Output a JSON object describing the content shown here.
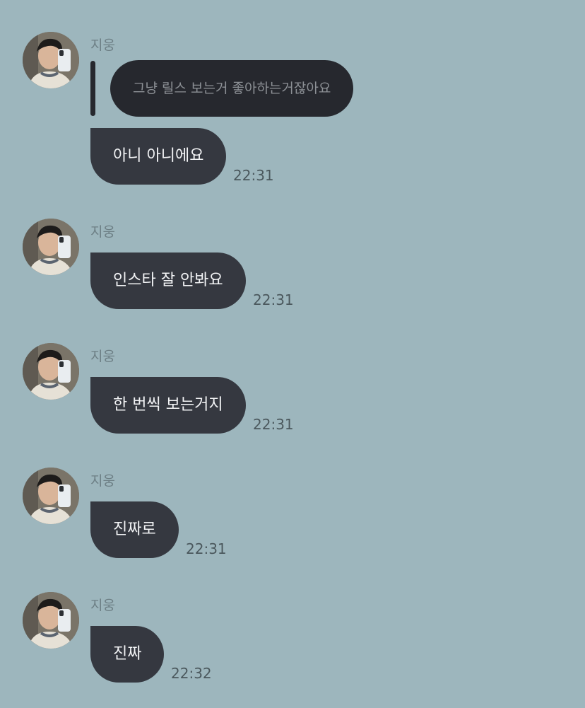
{
  "colors": {
    "background": "#9db6bd",
    "bubble": "#353840",
    "quote_bubble": "#26282e",
    "sender_name": "#6d7f85",
    "timestamp": "#4b585d"
  },
  "messages": [
    {
      "sender": "지웅",
      "avatar": "profile-photo",
      "reply_to": "그냥 릴스 보는거 좋아하는거잖아요",
      "text": "아니 아니에요",
      "time": "22:31"
    },
    {
      "sender": "지웅",
      "avatar": "profile-photo",
      "text": "인스타 잘 안봐요",
      "time": "22:31"
    },
    {
      "sender": "지웅",
      "avatar": "profile-photo",
      "text": "한 번씩 보는거지",
      "time": "22:31"
    },
    {
      "sender": "지웅",
      "avatar": "profile-photo",
      "text": "진짜로",
      "time": "22:31"
    },
    {
      "sender": "지웅",
      "avatar": "profile-photo",
      "text": "진짜",
      "time": "22:32"
    }
  ]
}
